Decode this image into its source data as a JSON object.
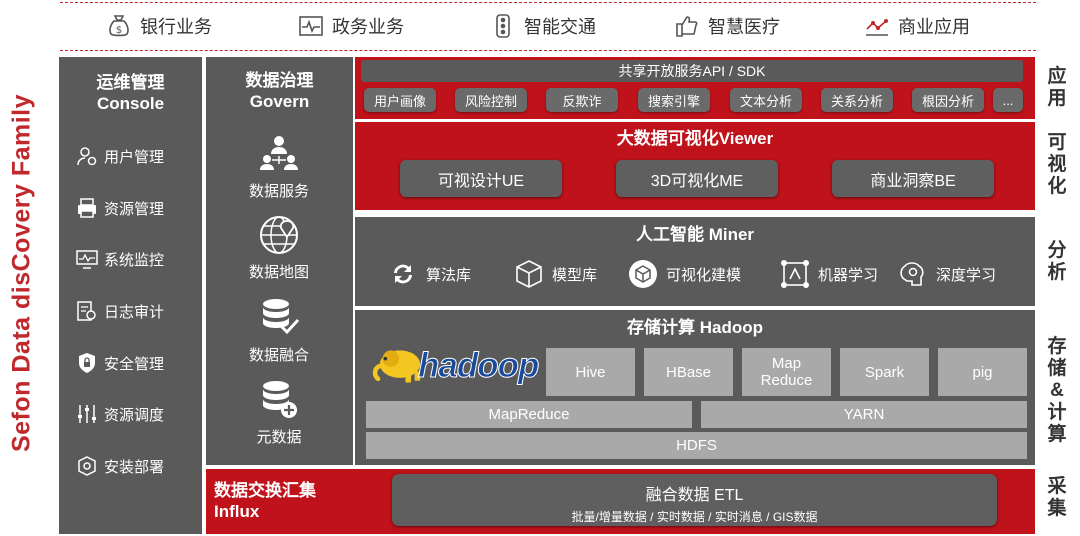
{
  "industries": [
    {
      "icon": "money-bag-icon",
      "label": "银行业务"
    },
    {
      "icon": "pulse-icon",
      "label": "政务业务"
    },
    {
      "icon": "traffic-light-icon",
      "label": "智能交通"
    },
    {
      "icon": "thumbs-up-icon",
      "label": "智慧医疗"
    },
    {
      "icon": "chart-line-icon",
      "label": "商业应用"
    }
  ],
  "family_title": "Sefon Data disCovery Family",
  "console": {
    "title_cn": "运维管理",
    "title_en": "Console",
    "items": [
      {
        "icon": "user-gear-icon",
        "label": "用户管理"
      },
      {
        "icon": "printer-icon",
        "label": "资源管理"
      },
      {
        "icon": "monitor-icon",
        "label": "系统监控"
      },
      {
        "icon": "log-search-icon",
        "label": "日志审计"
      },
      {
        "icon": "shield-lock-icon",
        "label": "安全管理"
      },
      {
        "icon": "sliders-icon",
        "label": "资源调度"
      },
      {
        "icon": "install-gear-icon",
        "label": "安装部署"
      }
    ]
  },
  "govern": {
    "title_cn": "数据治理",
    "title_en": "Govern",
    "items": [
      {
        "icon": "people-network-icon",
        "label": "数据服务"
      },
      {
        "icon": "globe-pin-icon",
        "label": "数据地图"
      },
      {
        "icon": "database-check-icon",
        "label": "数据融合"
      },
      {
        "icon": "database-plus-icon",
        "label": "元数据"
      }
    ]
  },
  "application": {
    "api_label": "共享开放服务API / SDK",
    "buttons": [
      "用户画像",
      "风险控制",
      "反欺诈",
      "搜索引擎",
      "文本分析",
      "关系分析",
      "根因分析",
      "..."
    ]
  },
  "viewer": {
    "title": "大数据可视化Viewer",
    "buttons": [
      "可视设计UE",
      "3D可视化ME",
      "商业洞察BE"
    ]
  },
  "miner": {
    "title": "人工智能 Miner",
    "items": [
      {
        "icon": "refresh-cycle-icon",
        "label": "算法库"
      },
      {
        "icon": "cube-model-icon",
        "label": "模型库"
      },
      {
        "icon": "cube-circle-icon",
        "label": "可视化建模"
      },
      {
        "icon": "robot-arm-icon",
        "label": "机器学习"
      },
      {
        "icon": "brain-gear-icon",
        "label": "深度学习"
      }
    ]
  },
  "hadoop": {
    "title": "存储计算 Hadoop",
    "logo_text": "hadoop",
    "components": [
      "Hive",
      "HBase",
      "Map\nReduce",
      "Spark",
      "pig"
    ],
    "mapreduce": "MapReduce",
    "yarn": "YARN",
    "hdfs": "HDFS"
  },
  "influx": {
    "title_cn": "数据交换汇集",
    "title_en": "Influx",
    "etl_title": "融合数据 ETL",
    "etl_sub": "批量/增量数据 / 实时数据 / 实时消息 / GIS数据"
  },
  "layers": {
    "application": "应用",
    "visualization": "可视化",
    "analysis": "分析",
    "storage": "存储&计算",
    "collection": "采集"
  },
  "colors": {
    "brand_red": "#c0121b",
    "panel_gray": "#5a5a5a",
    "component_gray": "#a9a9a9"
  }
}
